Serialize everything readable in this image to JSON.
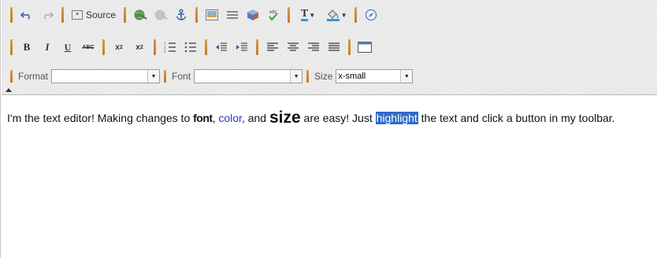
{
  "toolbar": {
    "source_label": "Source",
    "format": {
      "label": "Format",
      "value": ""
    },
    "font": {
      "label": "Font",
      "value": ""
    },
    "size": {
      "label": "Size",
      "value": "x-small"
    },
    "bold_glyph": "B",
    "italic_glyph": "I",
    "underline_glyph": "U",
    "strike_glyph": "ABC",
    "sub_glyph_base": "x",
    "sub_glyph_script": "2",
    "sup_glyph_base": "x",
    "sup_glyph_script": "2",
    "text_color_glyph": "T"
  },
  "content": {
    "t1": "I'm the text editor! Making changes to ",
    "font_word": "font",
    "t2": ", ",
    "color_word": "color",
    "t3": ", and ",
    "size_word": "size",
    "t4": " are easy! Just ",
    "highlight_word": "highlight",
    "t5": " the text and click a button in my toolbar."
  },
  "colors": {
    "separator": "#c98a3a",
    "color_word": "#2a36c9",
    "selection": "#2f6ac8"
  }
}
